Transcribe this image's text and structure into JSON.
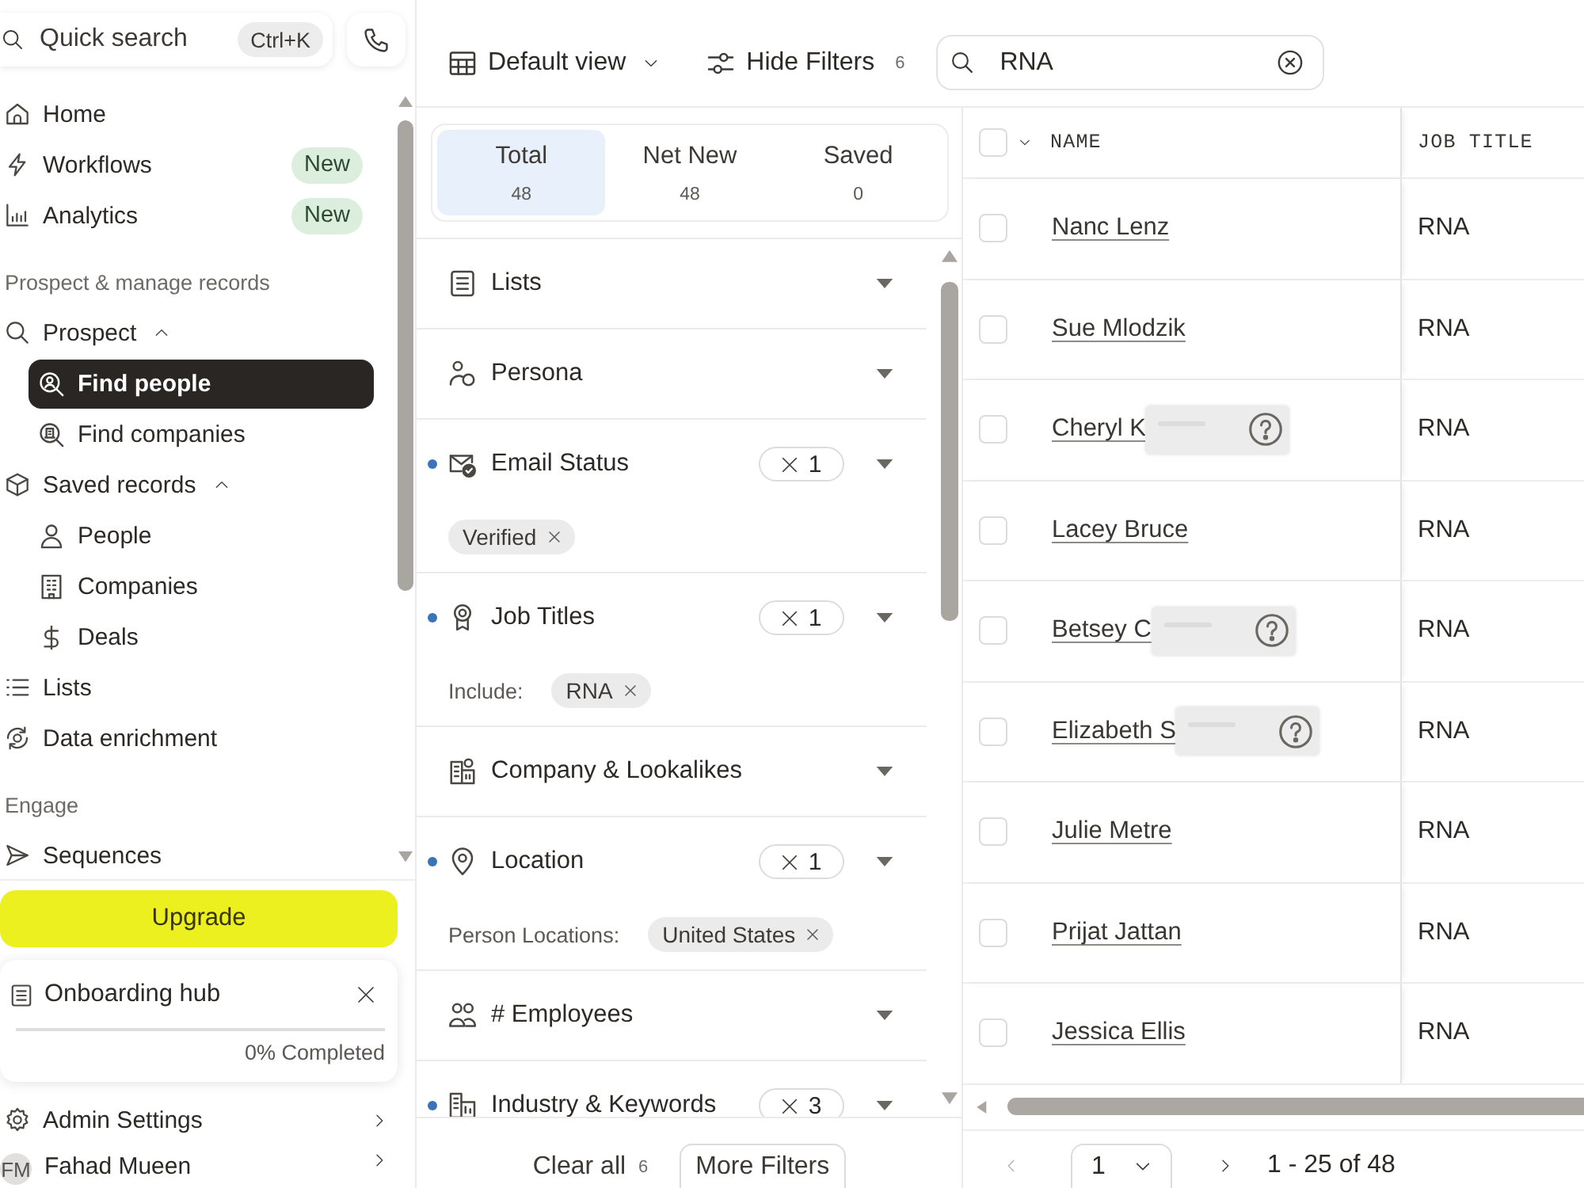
{
  "sidebar": {
    "quick_search": {
      "placeholder": "Quick search",
      "shortcut": "Ctrl+K"
    },
    "sections": [
      {
        "items": [
          {
            "label": "Home",
            "selected": false
          },
          {
            "label": "Workflows",
            "selected": false,
            "badge": "New"
          },
          {
            "label": "Analytics",
            "selected": false,
            "badge": "New"
          }
        ]
      },
      {
        "title": "Prospect & manage records",
        "items": [
          {
            "label": "Prospect",
            "selected": false,
            "expanded": true,
            "children": [
              {
                "label": "Find people",
                "selected": true
              },
              {
                "label": "Find companies",
                "selected": false
              }
            ]
          },
          {
            "label": "Saved records",
            "selected": false,
            "expanded": true,
            "children": [
              {
                "label": "People",
                "selected": false
              },
              {
                "label": "Companies",
                "selected": false
              },
              {
                "label": "Deals",
                "selected": false
              }
            ]
          },
          {
            "label": "Lists",
            "selected": false
          },
          {
            "label": "Data enrichment",
            "selected": false
          }
        ]
      },
      {
        "title": "Engage",
        "items": [
          {
            "label": "Sequences",
            "selected": false
          }
        ]
      }
    ],
    "upgrade_button": "Upgrade",
    "onboarding": {
      "title": "Onboarding hub",
      "level": 0,
      "progress_text": "0% Completed"
    },
    "bottom_items": [
      {
        "kind": "settings",
        "label": "Admin Settings"
      },
      {
        "kind": "user",
        "initials": "FM",
        "label": "Fahad Mueen"
      }
    ]
  },
  "toolbar": {
    "view_menu": "Default view",
    "filters_toggle": {
      "label": "Hide Filters",
      "count": "6"
    },
    "search": {
      "value": "RNA"
    }
  },
  "count_tabs": [
    {
      "label": "Total",
      "count": "48",
      "selected": true
    },
    {
      "label": "Net New",
      "count": "48",
      "selected": false
    },
    {
      "label": "Saved",
      "count": "0",
      "selected": false
    }
  ],
  "filters": [
    {
      "label": "Lists",
      "active": false
    },
    {
      "label": "Persona",
      "active": false
    },
    {
      "label": "Email Status",
      "active": true,
      "applied_count": "1",
      "chips": [
        "Verified"
      ]
    },
    {
      "label": "Job Titles",
      "active": true,
      "applied_count": "1",
      "qualifier": "Include:",
      "chips": [
        "RNA"
      ]
    },
    {
      "label": "Company & Lookalikes",
      "active": false
    },
    {
      "label": "Location",
      "active": true,
      "applied_count": "1",
      "qualifier": "Person Locations:",
      "chips": [
        "United States"
      ]
    },
    {
      "label": "# Employees",
      "active": false
    },
    {
      "label": "Industry & Keywords",
      "active": true,
      "applied_count": "3"
    }
  ],
  "filters_footer": {
    "clear_all": {
      "label": "Clear all",
      "count": "6"
    },
    "more_filters": "More Filters"
  },
  "table": {
    "all_selected": false,
    "columns": [
      "NAME",
      "JOB TITLE"
    ],
    "rows": [
      {
        "name": "Nanc Lenz",
        "masked": false,
        "job_title": "RNA",
        "selected": false
      },
      {
        "name": "Sue Mlodzik",
        "masked": false,
        "job_title": "RNA",
        "selected": false
      },
      {
        "name": "Cheryl K",
        "masked": true,
        "job_title": "RNA",
        "selected": false
      },
      {
        "name": "Lacey Bruce",
        "masked": false,
        "job_title": "RNA",
        "selected": false
      },
      {
        "name": "Betsey C",
        "masked": true,
        "job_title": "RNA",
        "selected": false
      },
      {
        "name": "Elizabeth S",
        "masked": true,
        "job_title": "RNA",
        "selected": false
      },
      {
        "name": "Julie Metre",
        "masked": false,
        "job_title": "RNA",
        "selected": false
      },
      {
        "name": "Prijat Jattan",
        "masked": false,
        "job_title": "RNA",
        "selected": false
      },
      {
        "name": "Jessica Ellis",
        "masked": false,
        "job_title": "RNA",
        "selected": false
      }
    ]
  },
  "pagination": {
    "previous": {
      "disabled": true
    },
    "page": "1",
    "next": {
      "disabled": false
    },
    "range": "1 - 25 of 48"
  }
}
